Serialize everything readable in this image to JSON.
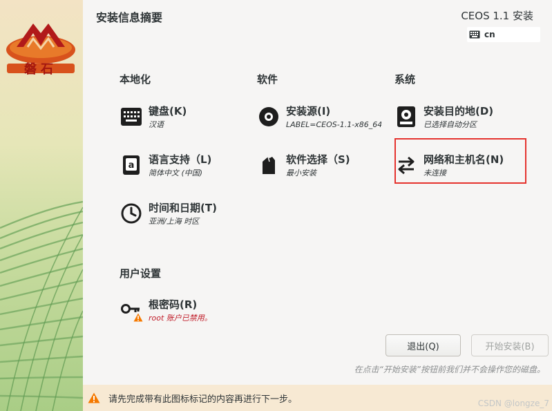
{
  "header": {
    "title": "安装信息摘要",
    "product": "CEOS 1.1 安装",
    "keyboard_layout": "cn"
  },
  "logo": {
    "text": "磐石"
  },
  "categories": {
    "localization": "本地化",
    "software": "软件",
    "system": "系统",
    "user_settings": "用户设置"
  },
  "spokes": {
    "keyboard": {
      "name": "键盘(K)",
      "status": "汉语",
      "icon": "keyboard-icon"
    },
    "language": {
      "name": "语言支持（L)",
      "status": "简体中文 (中国)",
      "icon": "language-icon"
    },
    "datetime": {
      "name": "时间和日期(T)",
      "status": "亚洲/上海 时区",
      "icon": "clock-icon"
    },
    "source": {
      "name": "安装源(I)",
      "status": "LABEL=CEOS-1.1-x86_64:",
      "icon": "disc-icon"
    },
    "software": {
      "name": "软件选择（S)",
      "status": "最小安装",
      "icon": "package-icon"
    },
    "destination": {
      "name": "安装目的地(D)",
      "status": "已选择自动分区",
      "icon": "harddisk-icon"
    },
    "network": {
      "name": "网络和主机名(N)",
      "status": "未连接",
      "icon": "network-icon"
    },
    "root": {
      "name": "根密码(R)",
      "status": "root 账户已禁用。",
      "icon": "key-icon"
    }
  },
  "buttons": {
    "quit": "退出(Q)",
    "begin": "开始安装(B)"
  },
  "hint": "在点击“开始安装”按钮前我们并不会操作您的磁盘。",
  "warning": "请先完成带有此图标标记的内容再进行下一步。",
  "watermark": "CSDN @longze_7",
  "colors": {
    "highlight": "#e5322d",
    "warning_bar": "#f7e9d3",
    "warning_icon": "#f57900",
    "error_text": "#c01c28"
  }
}
